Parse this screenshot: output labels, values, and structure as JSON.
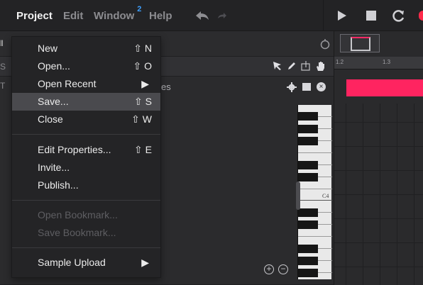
{
  "menubar": {
    "items": [
      {
        "label": "Project",
        "active": true
      },
      {
        "label": "Edit",
        "active": false
      },
      {
        "label": "Window",
        "active": false,
        "badge": "2"
      },
      {
        "label": "Help",
        "active": false
      }
    ],
    "undo_icon": "undo-arrow",
    "redo_icon": "redo-arrow",
    "transport": [
      "play",
      "stop",
      "loop",
      "record"
    ]
  },
  "project_menu": {
    "items": [
      {
        "label": "New",
        "shortcut": "⇧ N",
        "enabled": true
      },
      {
        "label": "Open...",
        "shortcut": "⇧ O",
        "enabled": true
      },
      {
        "label": "Open Recent",
        "shortcut": "▶",
        "enabled": true,
        "submenu": true
      },
      {
        "label": "Save...",
        "shortcut": "⇧ S",
        "enabled": true,
        "highlighted": true
      },
      {
        "label": "Close",
        "shortcut": "⇧ W",
        "enabled": true
      },
      {
        "label": "Edit Properties...",
        "shortcut": "⇧ E",
        "enabled": true
      },
      {
        "label": "Invite...",
        "shortcut": "",
        "enabled": true
      },
      {
        "label": "Publish...",
        "shortcut": "",
        "enabled": true
      },
      {
        "label": "Open Bookmark...",
        "shortcut": "",
        "enabled": false
      },
      {
        "label": "Save Bookmark...",
        "shortcut": "",
        "enabled": false
      },
      {
        "label": "Sample Upload",
        "shortcut": "▶",
        "enabled": true,
        "submenu": true
      }
    ]
  },
  "background": {
    "partial_label": "es",
    "ruler_labels": [
      "1.2",
      "1.3"
    ],
    "piano_label": "C4",
    "colors": {
      "note": "#ff2460",
      "accent": "#3ea0ff",
      "menu_bg": "#242426",
      "highlight": "#4a4a4e"
    }
  }
}
